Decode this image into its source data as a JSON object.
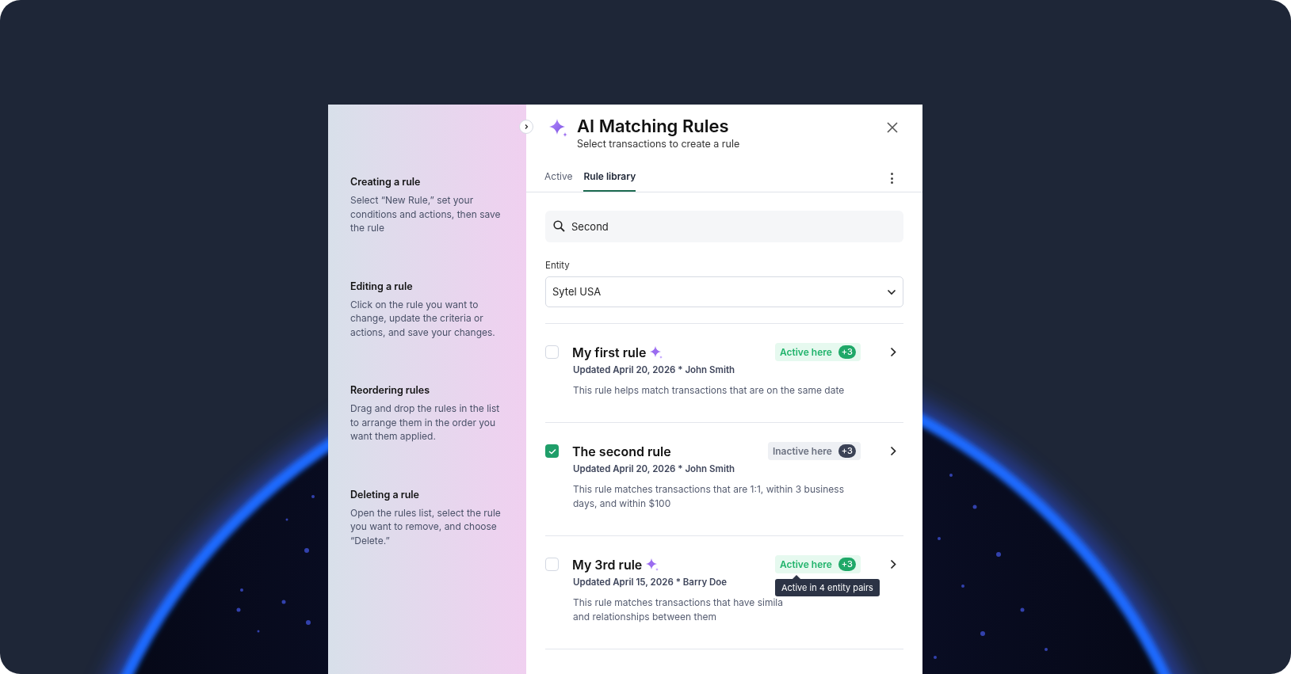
{
  "sidebar": {
    "sections": [
      {
        "heading": "Creating a rule",
        "body": "Select “New Rule,” set your conditions and actions, then save the rule"
      },
      {
        "heading": "Editing a rule",
        "body": "Click on the rule you want to change, update the criteria or actions, and save your changes."
      },
      {
        "heading": "Reordering rules",
        "body": "Drag and drop the rules in the list to arrange them in the order you want them applied."
      },
      {
        "heading": "Deleting a rule",
        "body": "Open the rules list, select the rule you want to remove, and choose “Delete.”"
      }
    ]
  },
  "header": {
    "title": "AI Matching Rules",
    "subtitle": "Select transactions to create a rule"
  },
  "tabs": [
    {
      "label": "Active",
      "selected": false
    },
    {
      "label": "Rule library",
      "selected": true
    }
  ],
  "search": {
    "value": "Second"
  },
  "entity": {
    "label": "Entity",
    "value": "Sytel USA"
  },
  "rules": [
    {
      "title": "My first rule",
      "ai": true,
      "checked": false,
      "status": {
        "kind": "active",
        "label": "Active here",
        "count": "+3"
      },
      "updated": "Updated April 20, 2026 * John Smith",
      "description": [
        "This rule helps match transactions that are on the same date"
      ]
    },
    {
      "title": "The second rule",
      "ai": false,
      "checked": true,
      "status": {
        "kind": "inactive",
        "label": "Inactive here",
        "count": "+3"
      },
      "updated": "Updated April 20, 2026 * John Smith",
      "description": [
        "This rule matches transactions that are 1:1, within 3 business",
        "days, and within $100"
      ]
    },
    {
      "title": "My 3rd rule",
      "ai": true,
      "checked": false,
      "status": {
        "kind": "active",
        "label": "Active here",
        "count": "+3"
      },
      "updated": "Updated April 15, 2026 * Barry Doe",
      "description": [
        "This rule matches transactions that have simila",
        "and relationships between them"
      ],
      "tooltip": "Active in 4 entity pairs"
    }
  ]
}
